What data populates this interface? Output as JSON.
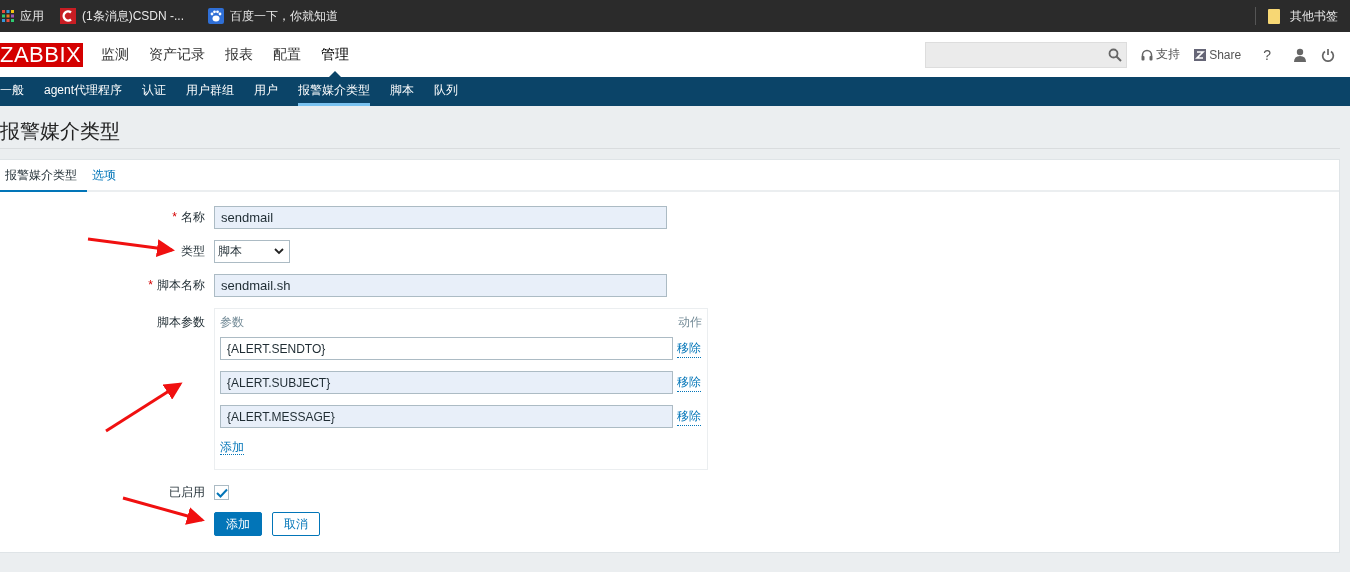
{
  "bookmarks_bar": {
    "items": [
      {
        "label": "应用",
        "kind": "apps"
      },
      {
        "label": "(1条消息)CSDN -...",
        "kind": "csdn"
      },
      {
        "label": "百度一下，你就知道",
        "kind": "baidu"
      }
    ],
    "other": "其他书签"
  },
  "header": {
    "logo": "ZABBIX",
    "menu": [
      {
        "label": "监测",
        "selected": false
      },
      {
        "label": "资产记录",
        "selected": false
      },
      {
        "label": "报表",
        "selected": false
      },
      {
        "label": "配置",
        "selected": false
      },
      {
        "label": "管理",
        "selected": true
      }
    ],
    "support": "支持",
    "share": "Share",
    "help": "?"
  },
  "subnav": [
    {
      "label": "一般",
      "selected": false
    },
    {
      "label": "agent代理程序",
      "selected": false
    },
    {
      "label": "认证",
      "selected": false
    },
    {
      "label": "用户群组",
      "selected": false
    },
    {
      "label": "用户",
      "selected": false
    },
    {
      "label": "报警媒介类型",
      "selected": true
    },
    {
      "label": "脚本",
      "selected": false
    },
    {
      "label": "队列",
      "selected": false
    }
  ],
  "page_title": "报警媒介类型",
  "tabs": [
    {
      "label": "报警媒介类型",
      "selected": true
    },
    {
      "label": "选项",
      "selected": false
    }
  ],
  "form": {
    "required_mark": "*",
    "name": {
      "label": "名称",
      "required": true,
      "value": "sendmail"
    },
    "type": {
      "label": "类型",
      "value": "脚本"
    },
    "script_name": {
      "label": "脚本名称",
      "required": true,
      "value": "sendmail.sh"
    },
    "script_params": {
      "label": "脚本参数",
      "header_param": "参数",
      "header_action": "动作",
      "add": "添加",
      "rows": [
        {
          "value": "{ALERT.SENDTO}",
          "highlighted": false,
          "action": "移除"
        },
        {
          "value": "{ALERT.SUBJECT}",
          "highlighted": true,
          "action": "移除"
        },
        {
          "value": "{ALERT.MESSAGE}",
          "highlighted": true,
          "action": "移除"
        }
      ]
    },
    "enabled": {
      "label": "已启用",
      "checked": true
    },
    "buttons": [
      {
        "label": "添加",
        "kind": "primary"
      },
      {
        "label": "取消",
        "kind": "secondary"
      }
    ]
  }
}
